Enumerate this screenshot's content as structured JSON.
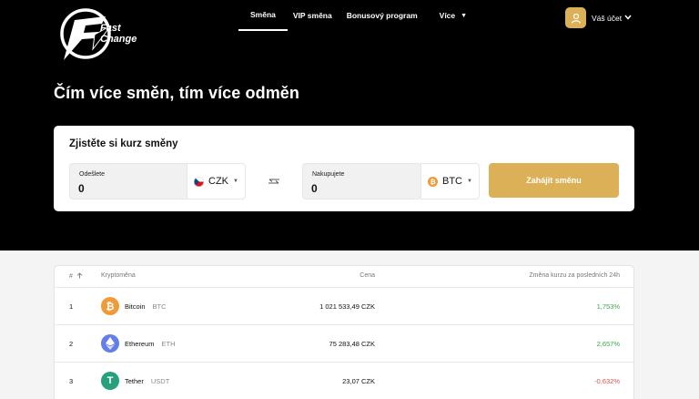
{
  "brand": {
    "line1": "Fast",
    "line2": "Change"
  },
  "nav": {
    "items": [
      {
        "label": "Směna"
      },
      {
        "label": "VIP směna"
      },
      {
        "label": "Bonusový program"
      },
      {
        "label": "Více"
      }
    ]
  },
  "account": {
    "label": "Váš účet",
    "icon": "user-icon"
  },
  "hero": {
    "headline": "Čím více směn, tím více odměn"
  },
  "exchange": {
    "title": "Zjistěte si kurz směny",
    "send_label": "Odešlete",
    "send_value": "0",
    "send_currency": "CZK",
    "buy_label": "Nakupujete",
    "buy_value": "0",
    "buy_currency": "BTC",
    "start_button": "Zahájit směnu"
  },
  "table": {
    "headers": {
      "rank": "#",
      "crypto": "Kryptoměna",
      "price": "Cena",
      "change": "Změna kurzu za posledních 24h"
    },
    "rows": [
      {
        "rank": "1",
        "name": "Bitcoin",
        "ticker": "BTC",
        "price": "1 021 533,49 CZK",
        "change": "1,753%",
        "trend": "up",
        "color": "#f09b39"
      },
      {
        "rank": "2",
        "name": "Ethereum",
        "ticker": "ETH",
        "price": "75 283,48 CZK",
        "change": "2,657%",
        "trend": "up",
        "color": "#627eea"
      },
      {
        "rank": "3",
        "name": "Tether",
        "ticker": "USDT",
        "price": "23,07 CZK",
        "change": "-0,632%",
        "trend": "down",
        "color": "#26a17b"
      }
    ]
  },
  "colors": {
    "accent": "#dcb057",
    "positive": "#3aa84c",
    "negative": "#d9534f"
  }
}
